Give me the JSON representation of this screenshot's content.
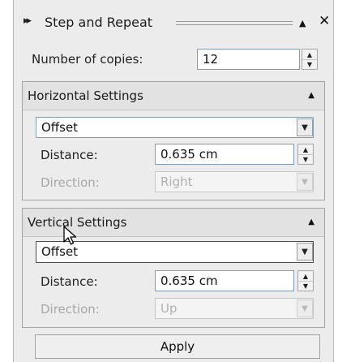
{
  "panel": {
    "grip": "▸▸",
    "title": "Step and Repeat",
    "collapse_glyph": "▲",
    "close_glyph": "✕"
  },
  "copies": {
    "label": "Number of copies:",
    "value": "12"
  },
  "horizontal": {
    "title": "Horizontal Settings",
    "mode": "Offset",
    "distance_label": "Distance:",
    "distance_value": "0.635 cm",
    "direction_label": "Direction:",
    "direction_value": "Right"
  },
  "vertical": {
    "title": "Vertical Settings",
    "mode": "Offset",
    "distance_label": "Distance:",
    "distance_value": "0.635 cm",
    "direction_label": "Direction:",
    "direction_value": "Up"
  },
  "apply_label": "Apply",
  "glyphs": {
    "spin_up": "▲",
    "spin_down": "▼",
    "dropdown": "▼",
    "collapse": "▲"
  },
  "colors": {
    "panel_bg": "#ececec",
    "field_border": "#7f9db9",
    "disabled_text": "#a8a8a8"
  }
}
